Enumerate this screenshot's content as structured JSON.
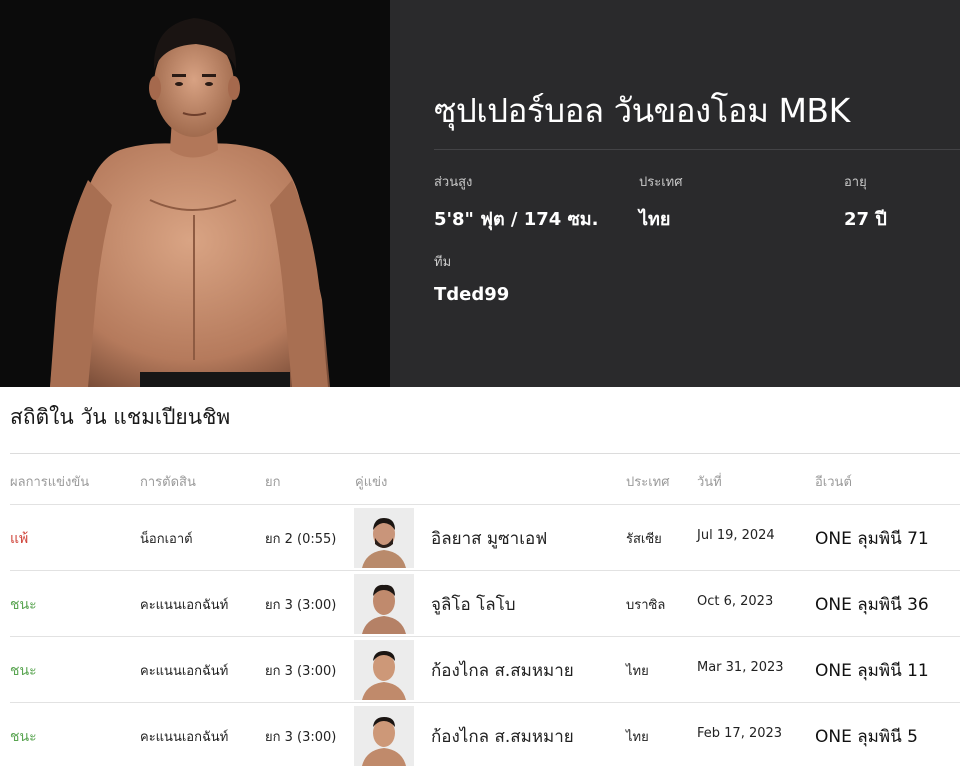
{
  "fighter": {
    "name": "ซุปเปอร์บอล วันของโอม MBK",
    "stats": [
      {
        "label": "ส่วนสูง",
        "value": "5'8\" ฟุต / 174 ซม."
      },
      {
        "label": "ประเทศ",
        "value": "ไทย"
      },
      {
        "label": "อายุ",
        "value": "27 ปี"
      },
      {
        "label": "ทีม",
        "value": "Tded99"
      }
    ]
  },
  "record": {
    "title": "สถิติใน วัน แชมเปียนชิพ",
    "columns": [
      "ผลการแข่งขัน",
      "การตัดสิน",
      "ยก",
      "คู่แข่ง",
      "ประเทศ",
      "วันที่",
      "อีเวนต์"
    ],
    "rows": [
      {
        "result": "แพ้",
        "result_color": "#d0453b",
        "method": "น็อกเอาต์",
        "round": "ยก 2 (0:55)",
        "opponent": "อิลยาส มูซาเอฟ",
        "country": "รัสเซีย",
        "date": "Jul 19, 2024",
        "event": "ONE ลุมพินี 71"
      },
      {
        "result": "ชนะ",
        "result_color": "#5aa552",
        "method": "คะแนนเอกฉันท์",
        "round": "ยก 3 (3:00)",
        "opponent": "จูลิโอ โลโบ",
        "country": "บราซิล",
        "date": "Oct 6, 2023",
        "event": "ONE ลุมพินี 36"
      },
      {
        "result": "ชนะ",
        "result_color": "#5aa552",
        "method": "คะแนนเอกฉันท์",
        "round": "ยก 3 (3:00)",
        "opponent": "ก้องไกล ส.สมหมาย",
        "country": "ไทย",
        "date": "Mar 31, 2023",
        "event": "ONE ลุมพินี 11"
      },
      {
        "result": "ชนะ",
        "result_color": "#5aa552",
        "method": "คะแนนเอกฉันท์",
        "round": "ยก 3 (3:00)",
        "opponent": "ก้องไกล ส.สมหมาย",
        "country": "ไทย",
        "date": "Feb 17, 2023",
        "event": "ONE ลุมพินี 5"
      }
    ]
  }
}
